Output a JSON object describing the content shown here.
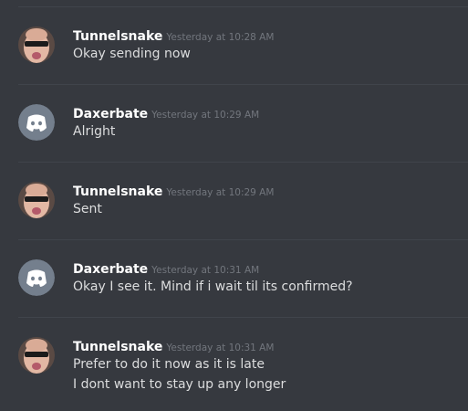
{
  "messages": [
    {
      "author": "Tunnelsnake",
      "avatar_icon": "sunglasses-face-avatar-icon",
      "timestamp": "Yesterday at 10:28 AM",
      "lines": [
        "Okay sending now"
      ]
    },
    {
      "author": "Daxerbate",
      "avatar_icon": "discord-logo-avatar-icon",
      "timestamp": "Yesterday at 10:29 AM",
      "lines": [
        "Alright"
      ]
    },
    {
      "author": "Tunnelsnake",
      "avatar_icon": "sunglasses-face-avatar-icon",
      "timestamp": "Yesterday at 10:29 AM",
      "lines": [
        "Sent"
      ]
    },
    {
      "author": "Daxerbate",
      "avatar_icon": "discord-logo-avatar-icon",
      "timestamp": "Yesterday at 10:31 AM",
      "lines": [
        "Okay I see it. Mind if i wait til its confirmed?"
      ]
    },
    {
      "author": "Tunnelsnake",
      "avatar_icon": "sunglasses-face-avatar-icon",
      "timestamp": "Yesterday at 10:31 AM",
      "lines": [
        "Prefer to do it now as it is late",
        "I dont want to stay up any longer"
      ]
    }
  ],
  "colors": {
    "background": "#36393f",
    "divider": "#40444b",
    "username": "#ffffff",
    "timestamp": "#72767d",
    "message_text": "#dcddde",
    "discord_avatar_bg": "#747f8d"
  }
}
